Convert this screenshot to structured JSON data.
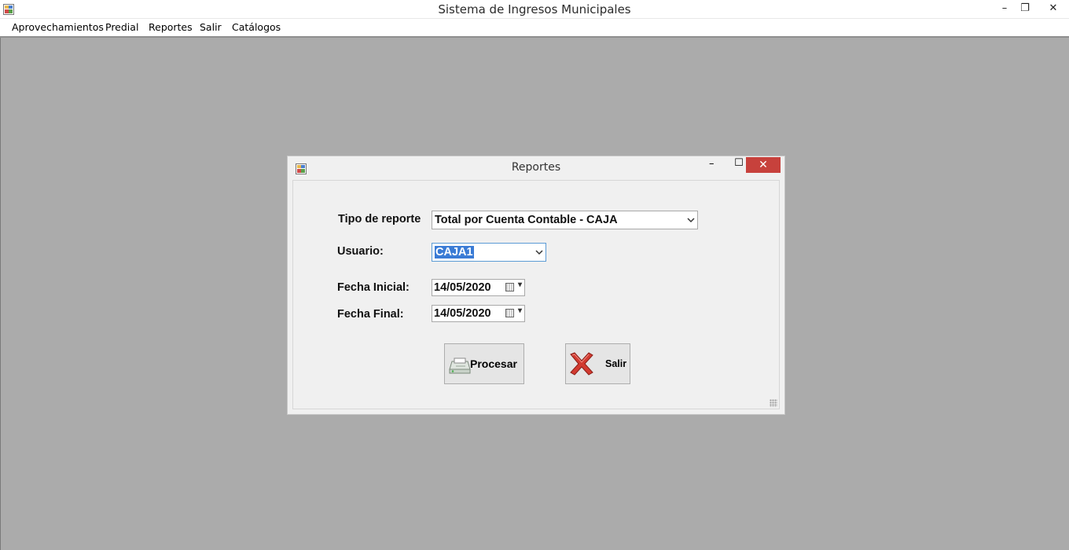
{
  "app": {
    "title": "Sistema de Ingresos Municipales"
  },
  "window_controls": {
    "minimize": "–",
    "restore": "❐",
    "close": "✕"
  },
  "menu": [
    "Aprovechamientos",
    "Predial",
    "Reportes",
    "Salir",
    "Catálogos"
  ],
  "form": {
    "title": "Reportes",
    "controls": {
      "minimize": "–",
      "maximize": "☐",
      "close": "✕"
    },
    "tipo_label": "Tipo de reporte",
    "tipo_value": "Total por Cuenta Contable - CAJA",
    "usuario_label": "Usuario:",
    "usuario_value": "CAJA1",
    "fecha_inicial_label": "Fecha Inicial:",
    "fecha_inicial_value": "14/05/2020",
    "fecha_final_label": "Fecha Final:",
    "fecha_final_value": "14/05/2020",
    "procesar_label": "Procesar",
    "salir_label": "Salir"
  },
  "icons": {
    "app": "app-window-icon",
    "procesar": "printer-icon",
    "salir": "red-x-icon",
    "dropdown": "chevron-down-icon",
    "calendar": "calendar-icon"
  }
}
